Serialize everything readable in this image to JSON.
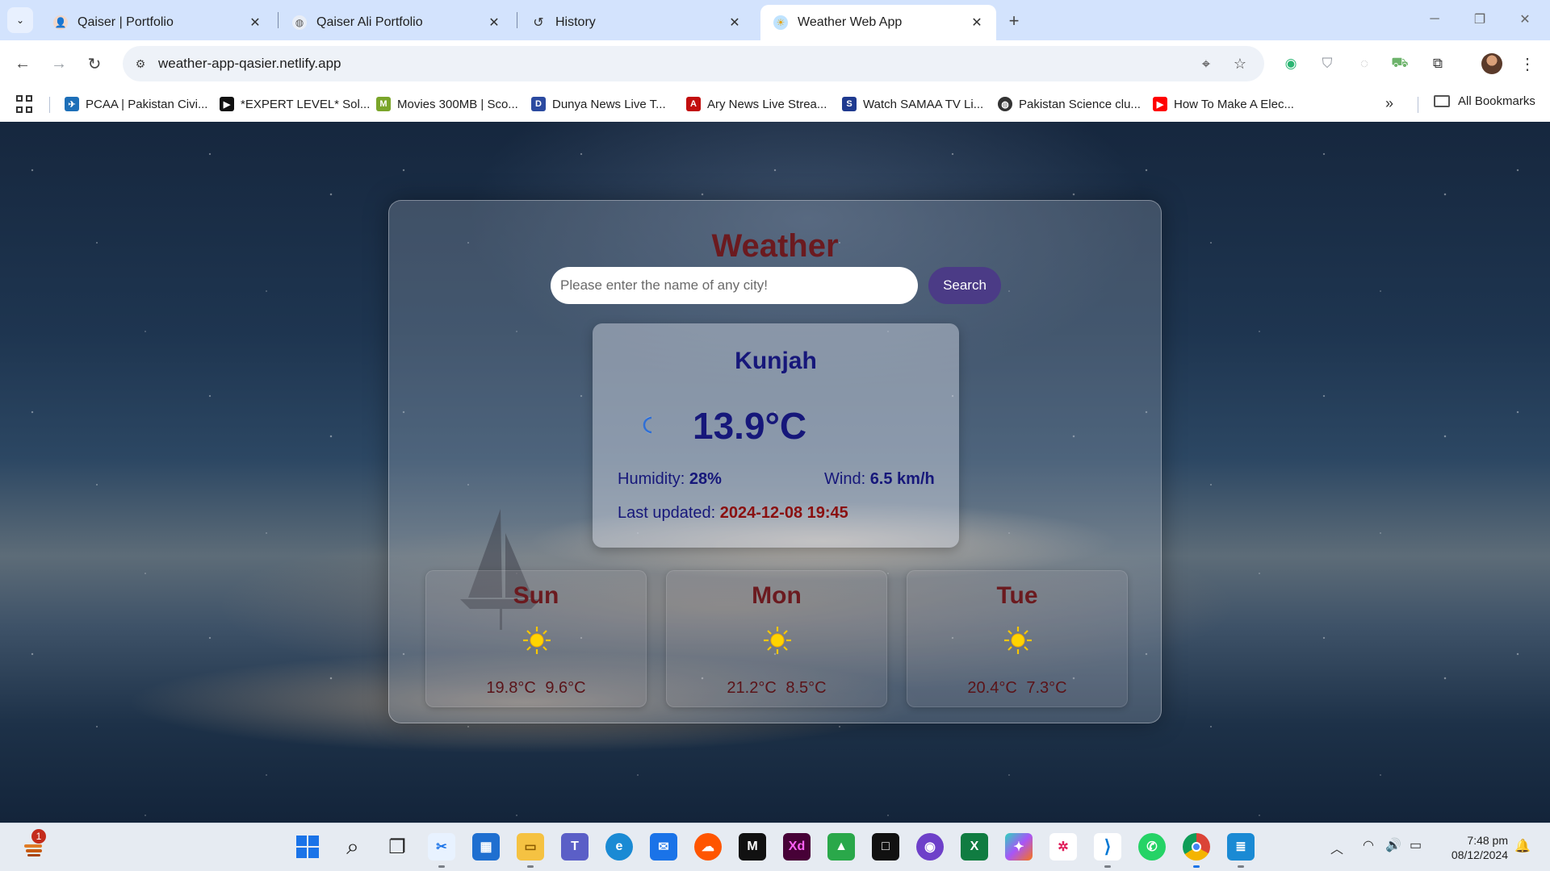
{
  "browser": {
    "tabs": [
      {
        "title": "Qaiser | Portfolio",
        "close": "✕"
      },
      {
        "title": "Qaiser Ali Portfolio",
        "close": "✕"
      },
      {
        "title": "History",
        "close": "✕"
      },
      {
        "title": "Weather Web App",
        "close": "✕",
        "active": true
      }
    ],
    "new_tab": "+",
    "url": "weather-app-qasier.netlify.app",
    "bookmarks": [
      {
        "label": "PCAA | Pakistan Civi...",
        "icon": "pcaa-icon"
      },
      {
        "label": "*EXPERT LEVEL* Sol...",
        "icon": "expert-icon"
      },
      {
        "label": "Movies 300MB | Sco...",
        "icon": "movies-icon"
      },
      {
        "label": "Dunya News Live T...",
        "icon": "dunya-icon"
      },
      {
        "label": "Ary News Live Strea...",
        "icon": "ary-icon"
      },
      {
        "label": "Watch SAMAA TV Li...",
        "icon": "samaa-icon"
      },
      {
        "label": "Pakistan Science clu...",
        "icon": "globe-icon"
      },
      {
        "label": "How To Make A Elec...",
        "icon": "youtube-icon"
      }
    ],
    "all_bookmarks": "All Bookmarks"
  },
  "weather": {
    "title": "Weather",
    "search_placeholder": "Please enter the name of any city!",
    "search_button": "Search",
    "city": "Kunjah",
    "condition_icon": "moon-icon",
    "temperature": "13.9°C",
    "humidity_label": "Humidity:",
    "humidity_value": "28%",
    "wind_label": "Wind:",
    "wind_value": "6.5 km/h",
    "last_updated_label": "Last updated:",
    "last_updated_value": "2024-12-08 19:45",
    "forecast": [
      {
        "day": "Sun",
        "icon": "sun-icon",
        "temps": "19.8°C 9.6°C"
      },
      {
        "day": "Mon",
        "icon": "sun-icon",
        "temps": "21.2°C 8.5°C"
      },
      {
        "day": "Tue",
        "icon": "sun-icon",
        "temps": "20.4°C 7.3°C"
      }
    ]
  },
  "taskbar": {
    "widgets_badge": "1",
    "time": "7:48 pm",
    "date": "08/12/2024"
  },
  "colors": {
    "title": "#6b1a1f",
    "city_text": "#16177a",
    "search_button": "#4b3b86",
    "last_updated": "#8a1010"
  }
}
